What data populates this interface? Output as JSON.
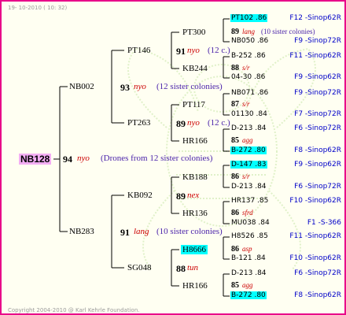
{
  "header": "19- 10-2010 ( 10: 32)",
  "footer": "Copyright 2004-2010 @ Karl Kehrle Foundation.",
  "root": {
    "id": "NB128",
    "year": "94",
    "line": "nyo",
    "note": "(Drones from 12 sister colonies)"
  },
  "gen1": [
    {
      "id": "NB002",
      "year": "93",
      "line": "nyo",
      "note": "(12 sister colonies)"
    },
    {
      "id": "NB283",
      "year": "91",
      "line": "lang",
      "note": "(10 sister colonies)"
    }
  ],
  "gen2": [
    {
      "id": "PT146",
      "year": "91",
      "line": "nyo",
      "note": "(12 c.)"
    },
    {
      "id": "PT263",
      "year": "89",
      "line": "nyo",
      "note": "(12 c.)"
    },
    {
      "id": "KB092",
      "year": "89",
      "line": "nex",
      "note": ""
    },
    {
      "id": "SG048",
      "year": "88",
      "line": "tun",
      "note": ""
    }
  ],
  "gen3": [
    {
      "id": "PT300",
      "year": "89",
      "line": "lang",
      "note": "(10 sister colonies)"
    },
    {
      "id": "KB244",
      "year": "88",
      "line": "s/r",
      "note": ""
    },
    {
      "id": "PT117",
      "year": "87",
      "line": "s/r",
      "note": ""
    },
    {
      "id": "HR166",
      "year": "85",
      "line": "agg",
      "note": ""
    },
    {
      "id": "KB188",
      "year": "86",
      "line": "s/r",
      "note": ""
    },
    {
      "id": "HR136",
      "year": "86",
      "line": "sfrd",
      "note": ""
    },
    {
      "id": "H8666",
      "year": "86",
      "line": "asp",
      "note": ""
    },
    {
      "id": "HR166",
      "year": "85",
      "line": "agg",
      "note": ""
    }
  ],
  "gen4": [
    {
      "id": "PT102 .86",
      "code": "F12 -Sinop62R"
    },
    {
      "id": "NB050 .86",
      "code": "F9 -Sinop72R"
    },
    {
      "id": "B-252 .86",
      "code": "F11 -Sinop62R"
    },
    {
      "id": "04-30 .86",
      "code": "F9 -Sinop62R"
    },
    {
      "id": "NB071 .86",
      "code": "F9 -Sinop72R"
    },
    {
      "id": "01130 .84",
      "code": "F7 -Sinop72R"
    },
    {
      "id": "D-213 .84",
      "code": "F6 -Sinop72R"
    },
    {
      "id": "B-272 .80",
      "code": "F8 -Sinop62R"
    },
    {
      "id": "D-147 .83",
      "code": "F9 -Sinop62R"
    },
    {
      "id": "D-213 .84",
      "code": "F6 -Sinop72R"
    },
    {
      "id": "HR137 .85",
      "code": "F10 -Sinop62R"
    },
    {
      "id": "MU038 .84",
      "code": "F1 -S-366"
    },
    {
      "id": "H8526 .85",
      "code": "F11 -Sinop62R"
    },
    {
      "id": "B-121 .84",
      "code": "F10 -Sinop62R"
    },
    {
      "id": "D-213 .84",
      "code": "F6 -Sinop72R"
    },
    {
      "id": "B-272 .80",
      "code": "F8 -Sinop62R"
    }
  ]
}
